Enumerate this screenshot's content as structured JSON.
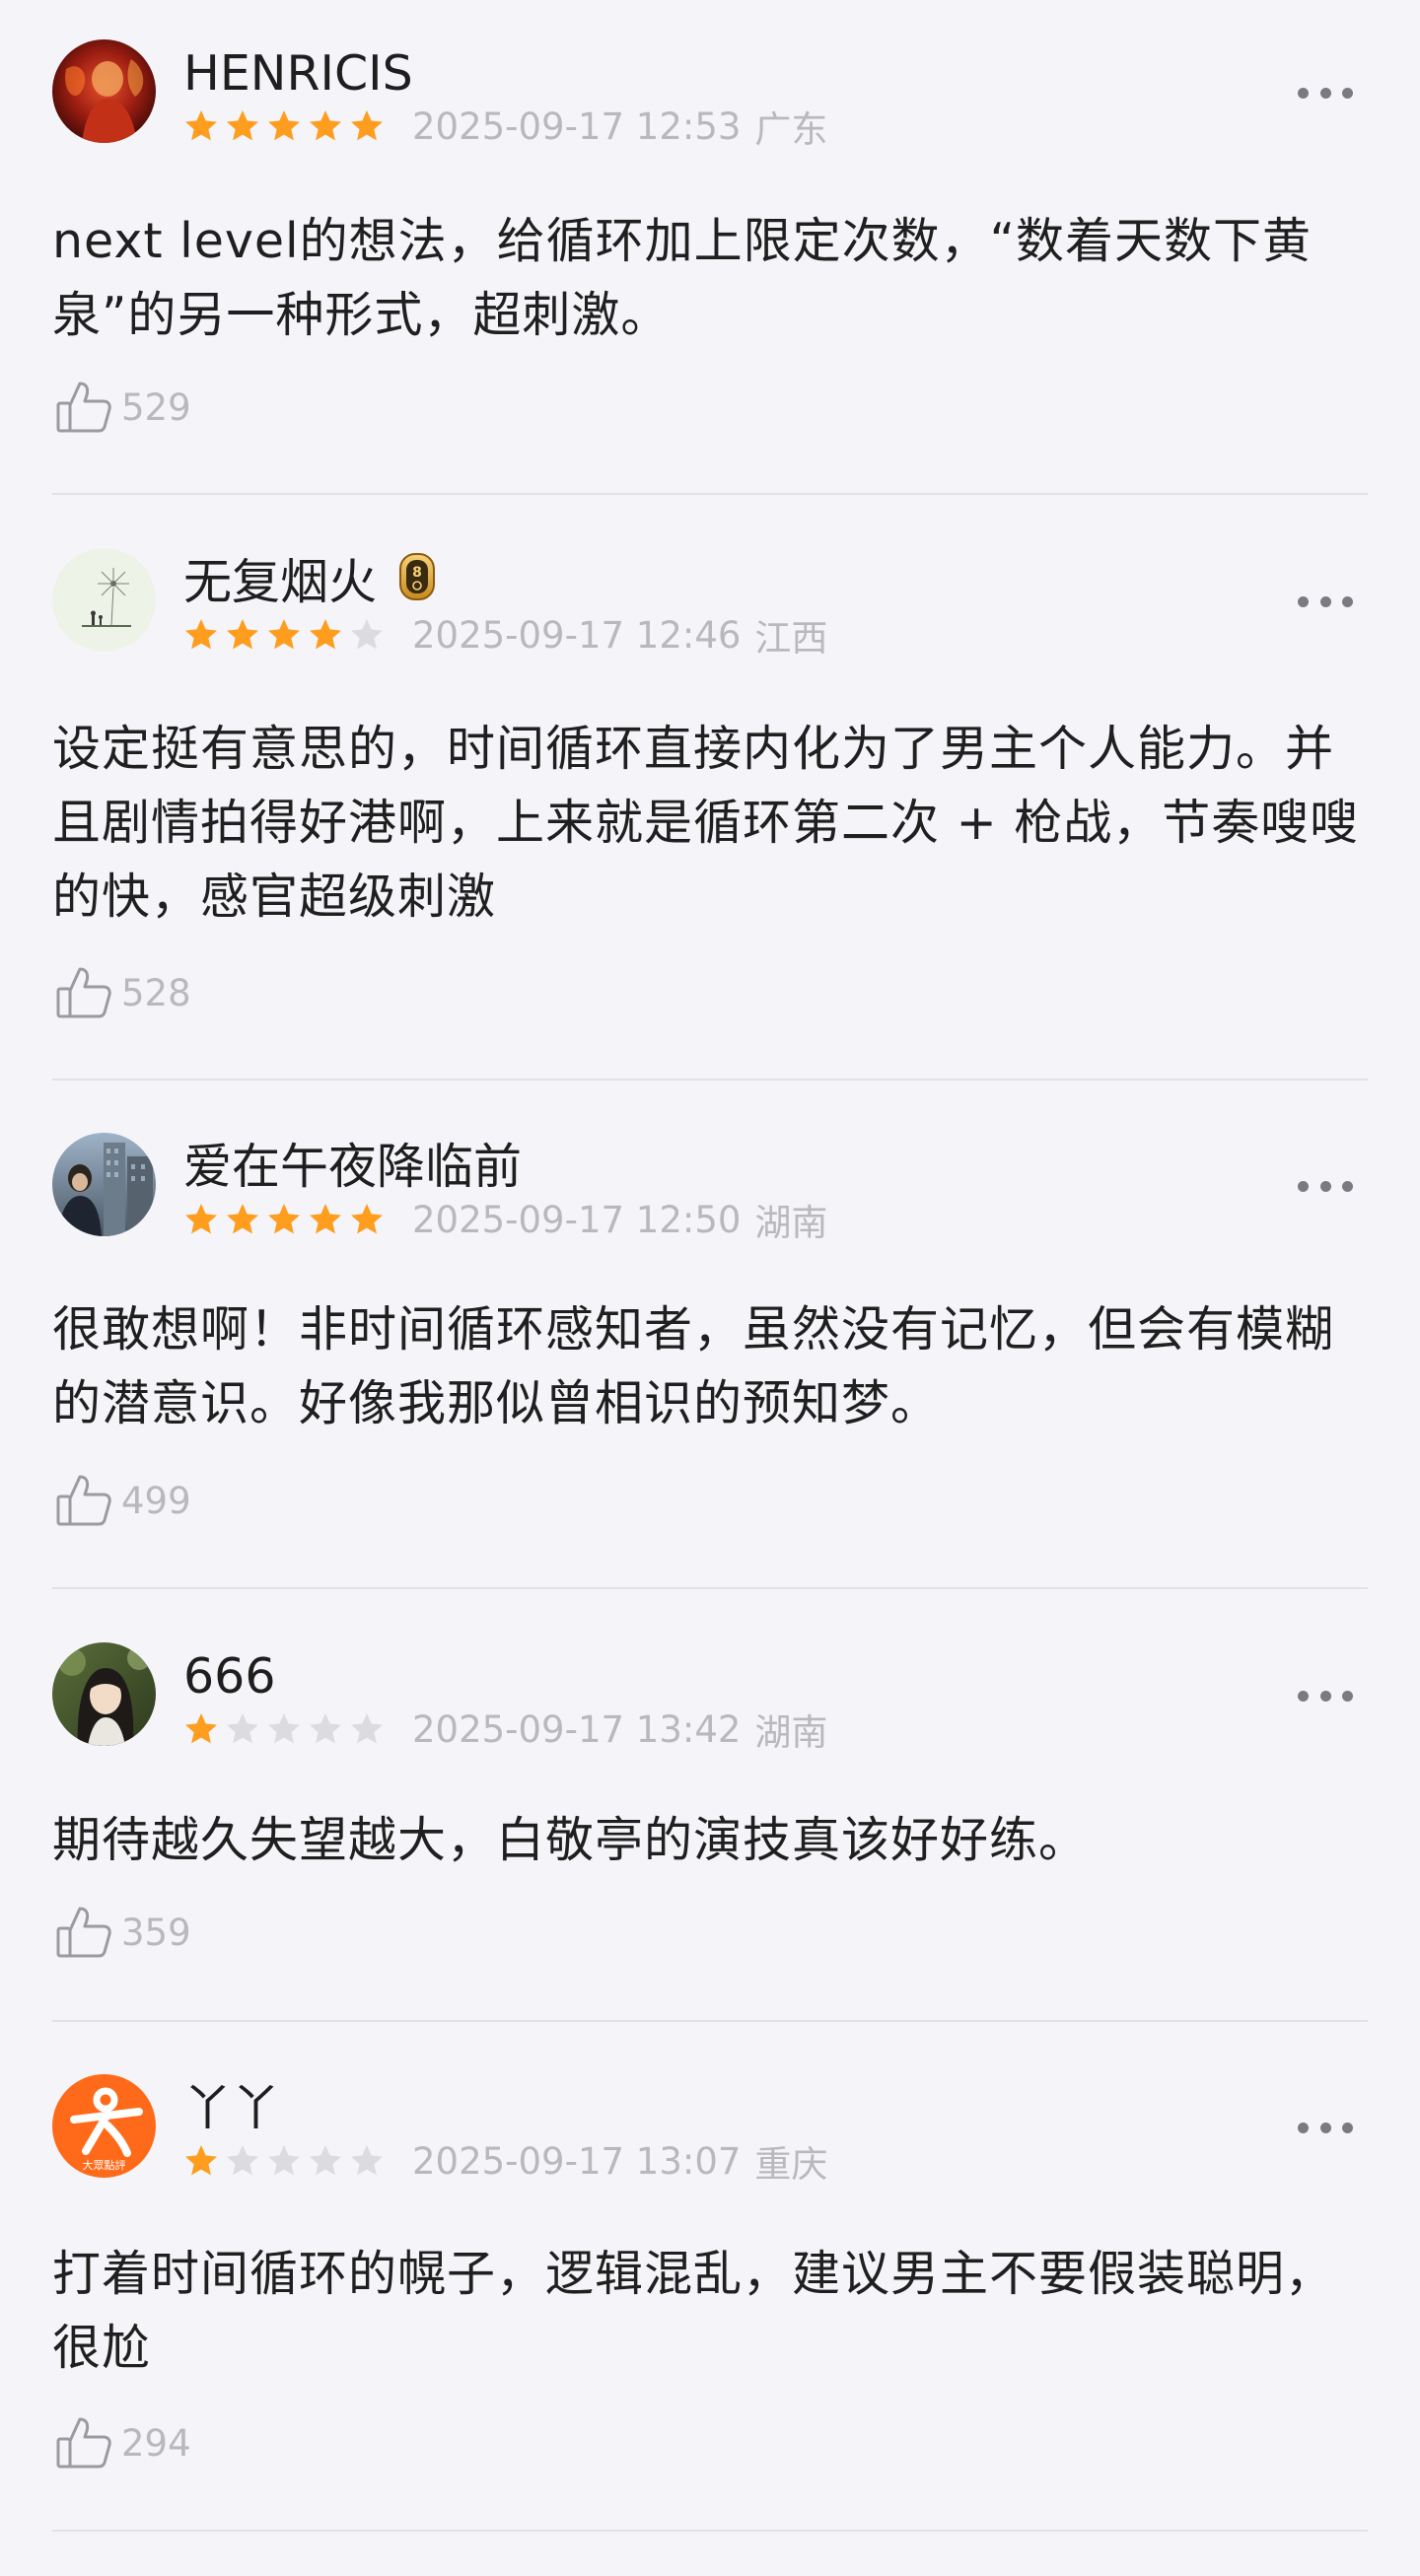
{
  "reviews": [
    {
      "username": "HENRICIS",
      "stars": 5,
      "date": "2025-09-17 12:53",
      "region": "广东",
      "content": "next level的想法，给循环加上限定次数，“数着天数下黄泉”的另一种形式，超刺激。",
      "likes": "529",
      "avatar": "red-abstract-portrait-avatar"
    },
    {
      "username": "无复烟火",
      "badge": "level-8-badge",
      "stars": 4,
      "date": "2025-09-17 12:46",
      "region": "江西",
      "content": "设定挺有意思的，时间循环直接内化为了男主个人能力。并且剧情拍得好港啊，上来就是循环第二次 + 枪战，节奏嗖嗖的快，感官超级刺激",
      "likes": "528",
      "avatar": "dandelion-illustration-avatar"
    },
    {
      "username": "爱在午夜降临前",
      "stars": 5,
      "date": "2025-09-17 12:50",
      "region": "湖南",
      "content": "很敢想啊！非时间循环感知者，虽然没有记忆，但会有模糊的潜意识。好像我那似曾相识的预知梦。",
      "likes": "499",
      "avatar": "city-photo-avatar"
    },
    {
      "username": "666",
      "stars": 1,
      "date": "2025-09-17 13:42",
      "region": "湖南",
      "content": "期待越久失望越大，白敬亭的演技真该好好练。",
      "likes": "359",
      "avatar": "girl-photo-avatar"
    },
    {
      "username": "丫丫",
      "stars": 1,
      "date": "2025-09-17 13:07",
      "region": "重庆",
      "content": "打着时间循环的幌子，逻辑混乱，建议男主不要假装聪明，很尬",
      "likes": "294",
      "avatar": "dianping-logo-avatar",
      "avatar_text": "大眾點評"
    }
  ],
  "colors": {
    "background": "#f5f5f9",
    "star_filled": "#ff9d1e",
    "star_empty": "#dcdce0",
    "meta_text": "#b8b8bd",
    "divider": "#e2e2e6",
    "dianping_orange": "#ff6a1a"
  }
}
